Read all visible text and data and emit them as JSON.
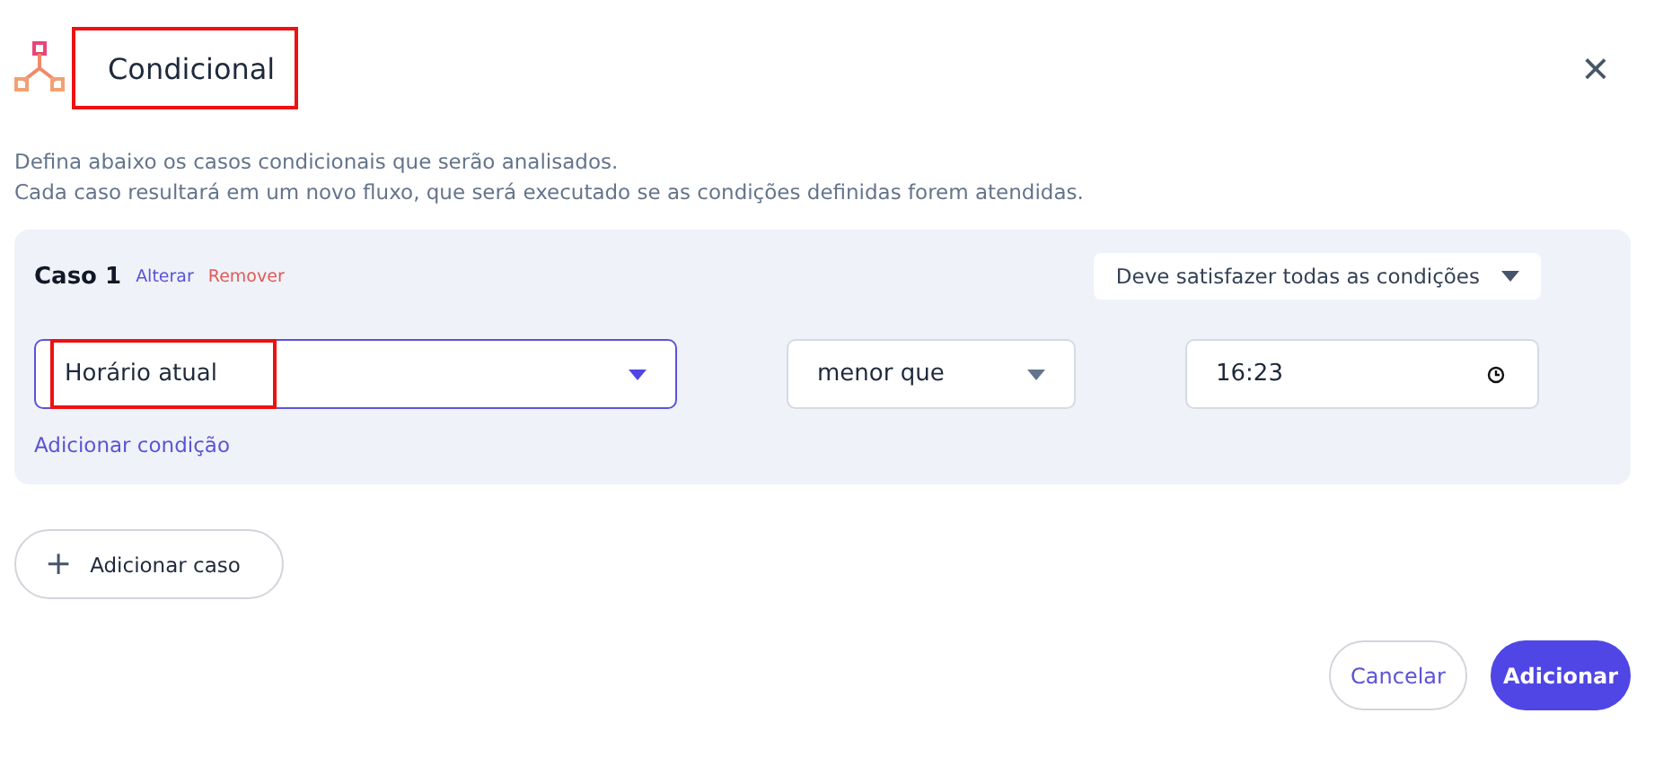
{
  "dialog": {
    "title": "Condicional",
    "close": "×",
    "title_highlighted": true
  },
  "description": [
    "Defina abaixo os casos condicionais que serão analisados.",
    "Cada caso resultará em um novo fluxo, que será executado se as condições definidas forem atendidas."
  ],
  "cases": [
    {
      "label": "Caso 1",
      "edit": "Alterar",
      "remove": "Remover",
      "match_mode": "Deve satisfazer todas as condições",
      "conditions": [
        {
          "field": "Horário atual",
          "field_focused": true,
          "field_highlighted": true,
          "operator": "menor que",
          "value": "16:23"
        }
      ],
      "add_condition": "Adicionar condição"
    }
  ],
  "add_case": {
    "icon": "+",
    "label": "Adicionar caso"
  },
  "buttons": [
    {
      "label": "Cancelar",
      "kind": "secondary"
    },
    {
      "label": "Adicionar",
      "kind": "primary"
    }
  ]
}
